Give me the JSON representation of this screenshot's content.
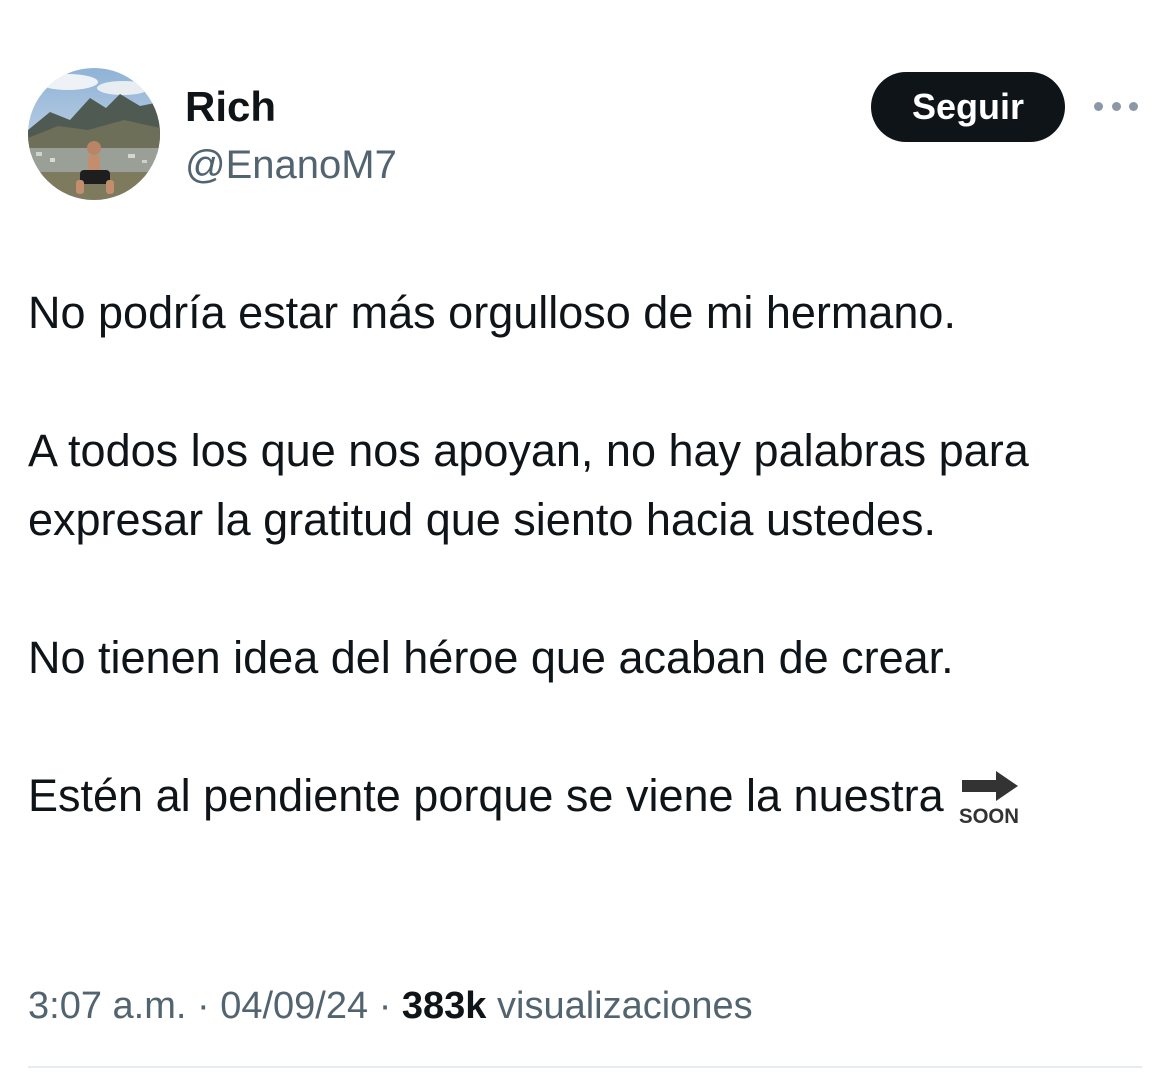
{
  "author": {
    "display_name": "Rich",
    "handle": "@EnanoM7"
  },
  "follow_label": "Seguir",
  "tweet": {
    "paragraphs": [
      "No podría estar más orgulloso de mi hermano.",
      "A todos los que nos apoyan, no hay palabras para expresar la gratitud que siento hacia ustedes.",
      "No tienen idea del héroe que acaban de crear.",
      "Estén al pendiente porque se viene la nuestra"
    ],
    "emoji_text": "SOON"
  },
  "meta": {
    "time": "3:07 a.m.",
    "separator": "·",
    "date": "04/09/24",
    "views_count": "383k",
    "views_label": "visualizaciones"
  },
  "colors": {
    "text": "#0f1419",
    "secondary": "#536471",
    "button_bg": "#0f1419",
    "button_text": "#ffffff",
    "divider": "#e6ecf0"
  }
}
